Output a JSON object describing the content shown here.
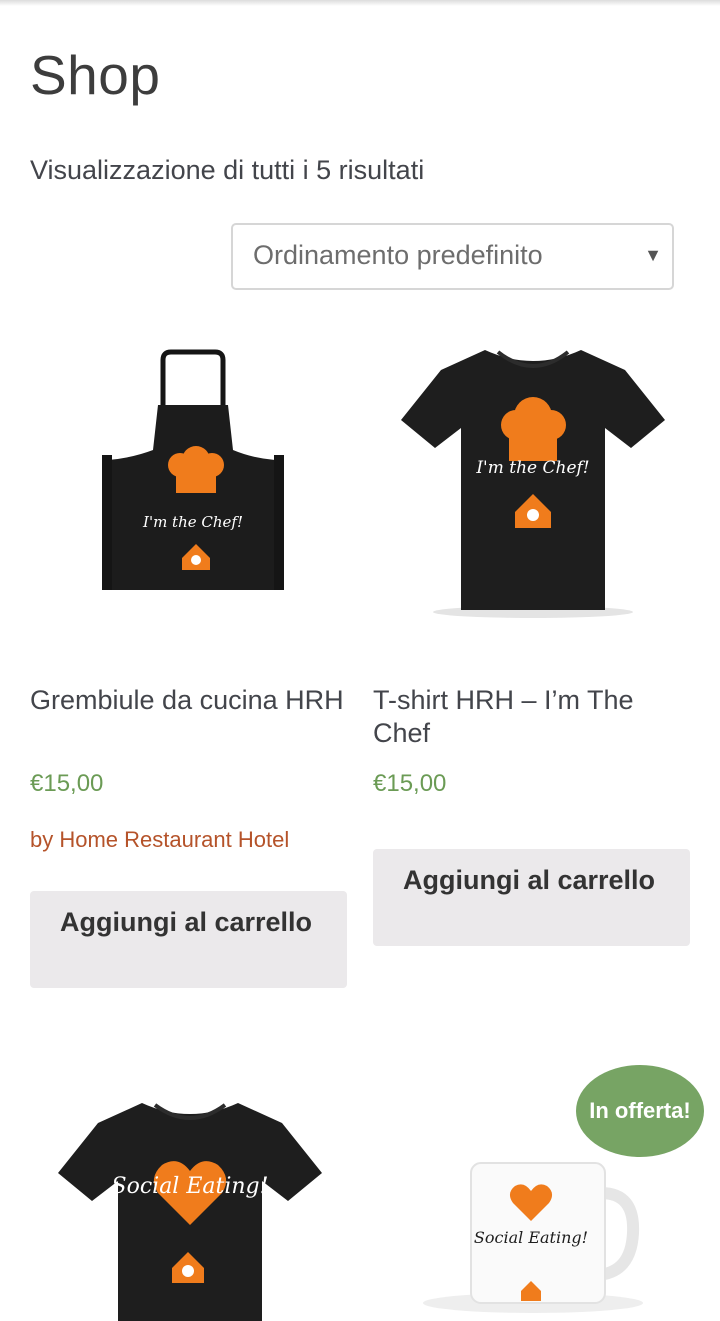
{
  "page": {
    "title": "Shop"
  },
  "results": {
    "count_text": "Visualizzazione di tutti i 5 risultati"
  },
  "ordering": {
    "selected": "Ordinamento predefinito"
  },
  "colors": {
    "price": "#6b9b55",
    "vendor": "#b5532a",
    "accent_orange": "#f07c1c",
    "badge": "#77a464"
  },
  "products": [
    {
      "image_icon": "apron-image",
      "image_text": "I'm the Chef!",
      "title": "Grembiule da cucina HRH",
      "price": "€15,00",
      "vendor": "by Home Restaurant Hotel",
      "button": "Aggiungi al carrello"
    },
    {
      "image_icon": "tshirt-chef-image",
      "image_text": "I'm the Chef!",
      "title": "T-shirt HRH – I’m The Chef",
      "price": "€15,00",
      "button": "Aggiungi al carrello"
    },
    {
      "image_icon": "tshirt-social-eating-image",
      "image_text": "Social Eating!"
    },
    {
      "image_icon": "mug-social-eating-image",
      "image_text": "Social Eating!",
      "badge": "In offerta!"
    }
  ]
}
